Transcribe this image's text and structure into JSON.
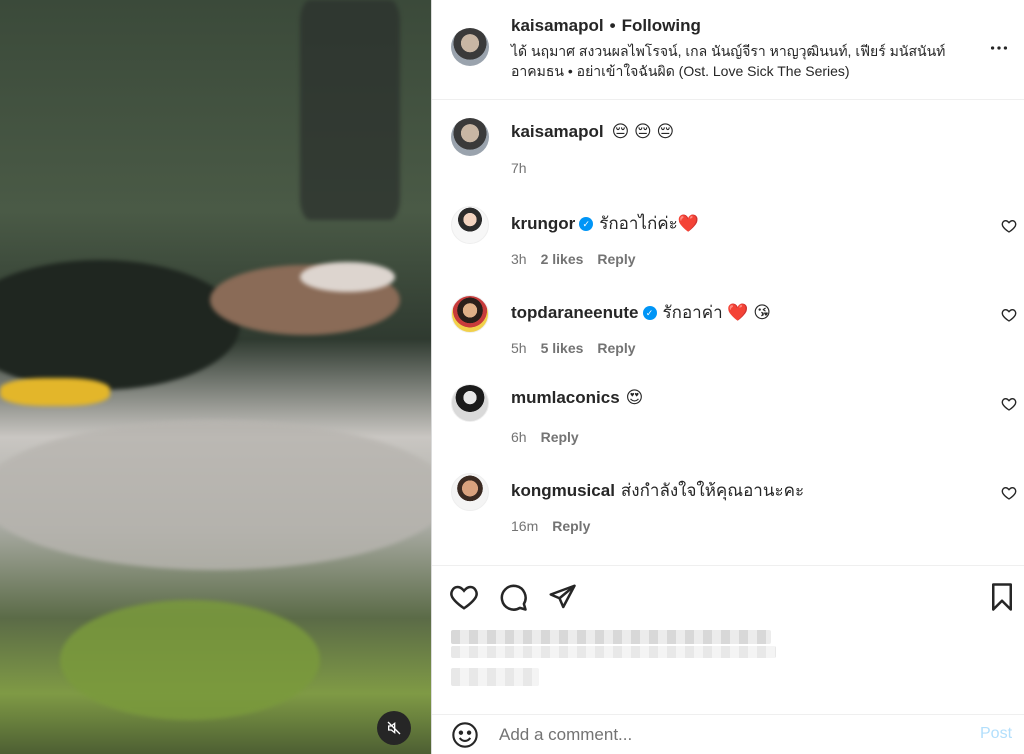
{
  "post": {
    "username": "kaisamapol",
    "separator": "•",
    "follow_status": "Following",
    "audio": "ได้ นฤมาศ สงวนผลไพโรจน์, เกล นันญ์จีรา หาญวุฒินนท์, เฟียร์ มนัสนันท์ อาคมธน • อย่าเข้าใจฉันผิด (Ost. Love Sick The Series)"
  },
  "caption": {
    "username": "kaisamapol",
    "text": "😔 😔 😔",
    "time": "7h"
  },
  "comments": [
    {
      "username": "krungor",
      "verified": true,
      "text": "รักอาไก่ค่ะ❤️",
      "time": "3h",
      "likes": "2 likes",
      "reply": "Reply"
    },
    {
      "username": "topdaraneenute",
      "verified": true,
      "text": "รักอาค่า ❤️ 😘",
      "time": "5h",
      "likes": "5 likes",
      "reply": "Reply"
    },
    {
      "username": "mumlaconics",
      "verified": false,
      "text": "😍",
      "time": "6h",
      "likes": "",
      "reply": "Reply"
    },
    {
      "username": "kongmusical",
      "verified": false,
      "text": "ส่งกำลังใจให้คุณอานะคะ",
      "time": "16m",
      "likes": "",
      "reply": "Reply"
    }
  ],
  "composer": {
    "placeholder": "Add a comment...",
    "post_label": "Post"
  },
  "icons": {
    "mute": "speaker-muted-icon",
    "more": "more-horizontal-icon",
    "like": "heart-icon",
    "comment": "comment-bubble-icon",
    "share": "paper-plane-icon",
    "save": "bookmark-icon",
    "emoji": "smiley-icon"
  },
  "colors": {
    "verified": "#0095f6",
    "muted_text": "#737373",
    "post_disabled": "#b2dffc"
  }
}
